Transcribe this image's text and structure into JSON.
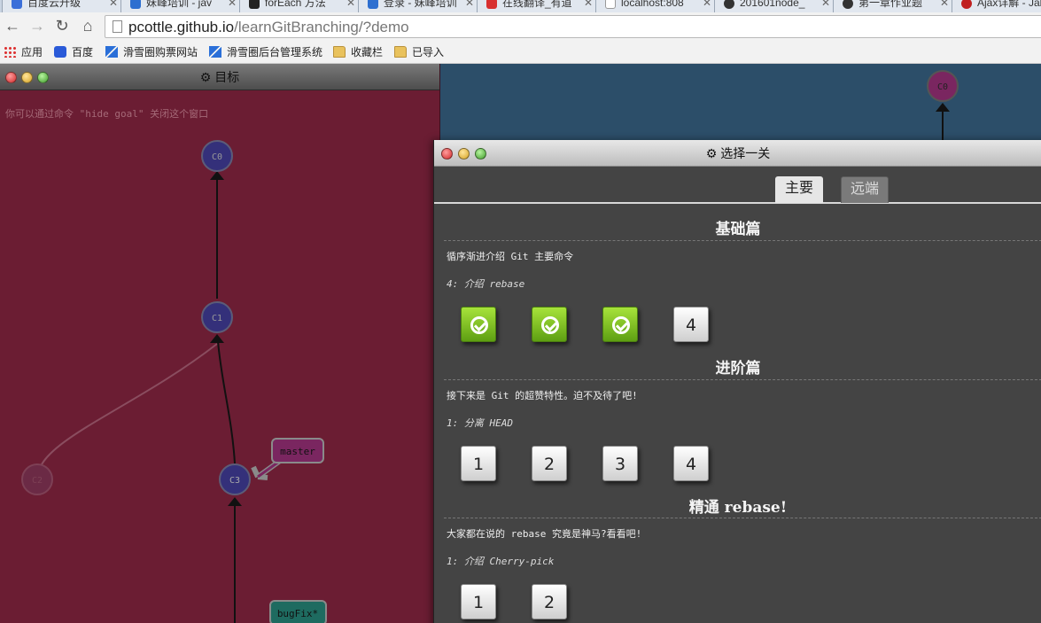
{
  "browser": {
    "tabs": [
      {
        "label": "百度云升级",
        "icon_color": "#3b6fd9"
      },
      {
        "label": "妹峰培训 - jav",
        "icon_color": "#2d6fd0"
      },
      {
        "label": "forEach 方法",
        "icon_color": "#222222"
      },
      {
        "label": "登录 - 妹峰培训",
        "icon_color": "#2d6fd0"
      },
      {
        "label": "在线翻译_有道",
        "icon_color": "#d83030"
      },
      {
        "label": "localhost:808",
        "icon_color": "#aaaaaa"
      },
      {
        "label": "201601node_",
        "icon_color": "#333333"
      },
      {
        "label": "第一章作业题",
        "icon_color": "#333333"
      },
      {
        "label": "Ajax详解 - Jab",
        "icon_color": "#c02020"
      }
    ],
    "nav": {
      "back": "←",
      "forward": "→",
      "reload": "↻",
      "home": "⌂"
    },
    "url": {
      "host": "pcottle.github.io",
      "path": "/learnGitBranching/?demo"
    },
    "bookmarks": [
      {
        "label": "应用",
        "icon": "apps-icon"
      },
      {
        "label": "百度",
        "icon": "baidu-paw-icon"
      },
      {
        "label": "滑雪圈购票网站",
        "icon": "skiing-icon"
      },
      {
        "label": "滑雪圈后台管理系统",
        "icon": "skiing-icon"
      },
      {
        "label": "收藏栏",
        "icon": "folder-icon"
      },
      {
        "label": "已导入",
        "icon": "folder-icon"
      }
    ]
  },
  "goal_window": {
    "title": "目标",
    "title_icon": "⚙",
    "hint": "你可以通过命令 \"hide goal\" 关闭这个窗口",
    "commits": [
      "C0",
      "C1",
      "C2",
      "C3"
    ],
    "branches": [
      "master",
      "bugFix*"
    ]
  },
  "main_canvas": {
    "commits": [
      "C0"
    ]
  },
  "level_window": {
    "title": "选择一关",
    "title_icon": "⚙",
    "tabs": [
      {
        "label": "主要",
        "active": true
      },
      {
        "label": "远端",
        "active": false
      }
    ],
    "sections": [
      {
        "title": "基础篇",
        "description": "循序渐进介绍 Git 主要命令",
        "current_level": "4: 介绍 rebase",
        "levels": [
          {
            "label": "1",
            "done": true
          },
          {
            "label": "2",
            "done": true
          },
          {
            "label": "3",
            "done": true
          },
          {
            "label": "4",
            "done": false
          }
        ]
      },
      {
        "title": "进阶篇",
        "description": "接下来是 Git 的超赞特性。迫不及待了吧!",
        "current_level": "1: 分离 HEAD",
        "levels": [
          {
            "label": "1",
            "done": false
          },
          {
            "label": "2",
            "done": false
          },
          {
            "label": "3",
            "done": false
          },
          {
            "label": "4",
            "done": false
          }
        ]
      },
      {
        "title": "精通 rebase!",
        "description": "大家都在说的 rebase 究竟是神马?看看吧!",
        "current_level": "1: 介绍 Cherry-pick",
        "levels": [
          {
            "label": "1",
            "done": false
          },
          {
            "label": "2",
            "done": false
          }
        ]
      }
    ]
  }
}
